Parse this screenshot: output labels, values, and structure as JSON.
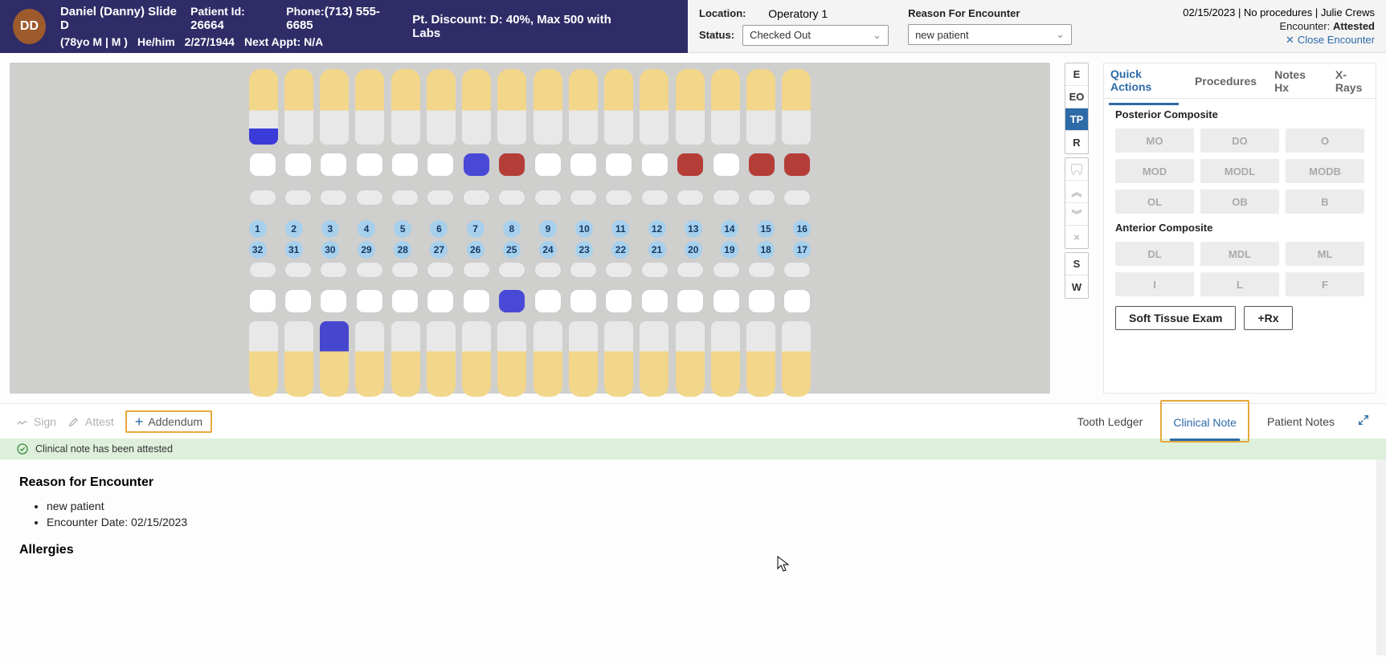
{
  "patient": {
    "initials": "DD",
    "name": "Daniel (Danny) Slide D",
    "idLabel": "Patient Id:",
    "id": "26664",
    "phoneLabel": "Phone:",
    "phone": "(713) 555-6685",
    "ageSex": "(78yo M | M )",
    "pronouns": "He/him",
    "dob": "2/27/1944",
    "nextApptLabel": "Next Appt:",
    "nextAppt": "N/A",
    "discount": "Pt. Discount: D: 40%, Max 500 with Labs"
  },
  "headerRight": {
    "locationLabel": "Location:",
    "location": "Operatory 1",
    "statusLabel": "Status:",
    "status": "Checked Out",
    "reasonLabel": "Reason For Encounter",
    "reason": "new patient",
    "metaLine": "02/15/2023 | No procedures | Julie Crews",
    "encounterLabel": "Encounter:",
    "encounterState": "Attested",
    "close": "Close Encounter"
  },
  "teethTop": [
    "1",
    "2",
    "3",
    "4",
    "5",
    "6",
    "7",
    "8",
    "9",
    "10",
    "11",
    "12",
    "13",
    "14",
    "15",
    "16"
  ],
  "teethBot": [
    "32",
    "31",
    "30",
    "29",
    "28",
    "27",
    "26",
    "25",
    "24",
    "23",
    "22",
    "21",
    "20",
    "19",
    "18",
    "17"
  ],
  "rail": {
    "g1": [
      "E",
      "EO",
      "TP",
      "R"
    ],
    "g3": [
      "S",
      "W"
    ]
  },
  "quick": {
    "tabs": [
      "Quick Actions",
      "Procedures",
      "Notes Hx",
      "X-Rays"
    ],
    "posteriorTitle": "Posterior Composite",
    "posterior": [
      "MO",
      "DO",
      "O",
      "MOD",
      "MODL",
      "MODB",
      "OL",
      "OB",
      "B"
    ],
    "anteriorTitle": "Anterior Composite",
    "anterior": [
      "DL",
      "MDL",
      "ML",
      "I",
      "L",
      "F"
    ],
    "softTissue": "Soft Tissue Exam",
    "rx": "+Rx"
  },
  "lower": {
    "sign": "Sign",
    "attest": "Attest",
    "addendum": "Addendum",
    "tabs": [
      "Tooth Ledger",
      "Clinical Note",
      "Patient Notes"
    ]
  },
  "banner": "Clinical note has been attested",
  "note": {
    "reasonTitle": "Reason for Encounter",
    "reasonItems": [
      "new patient",
      "Encounter Date: 02/15/2023"
    ],
    "allergiesTitle": "Allergies"
  }
}
